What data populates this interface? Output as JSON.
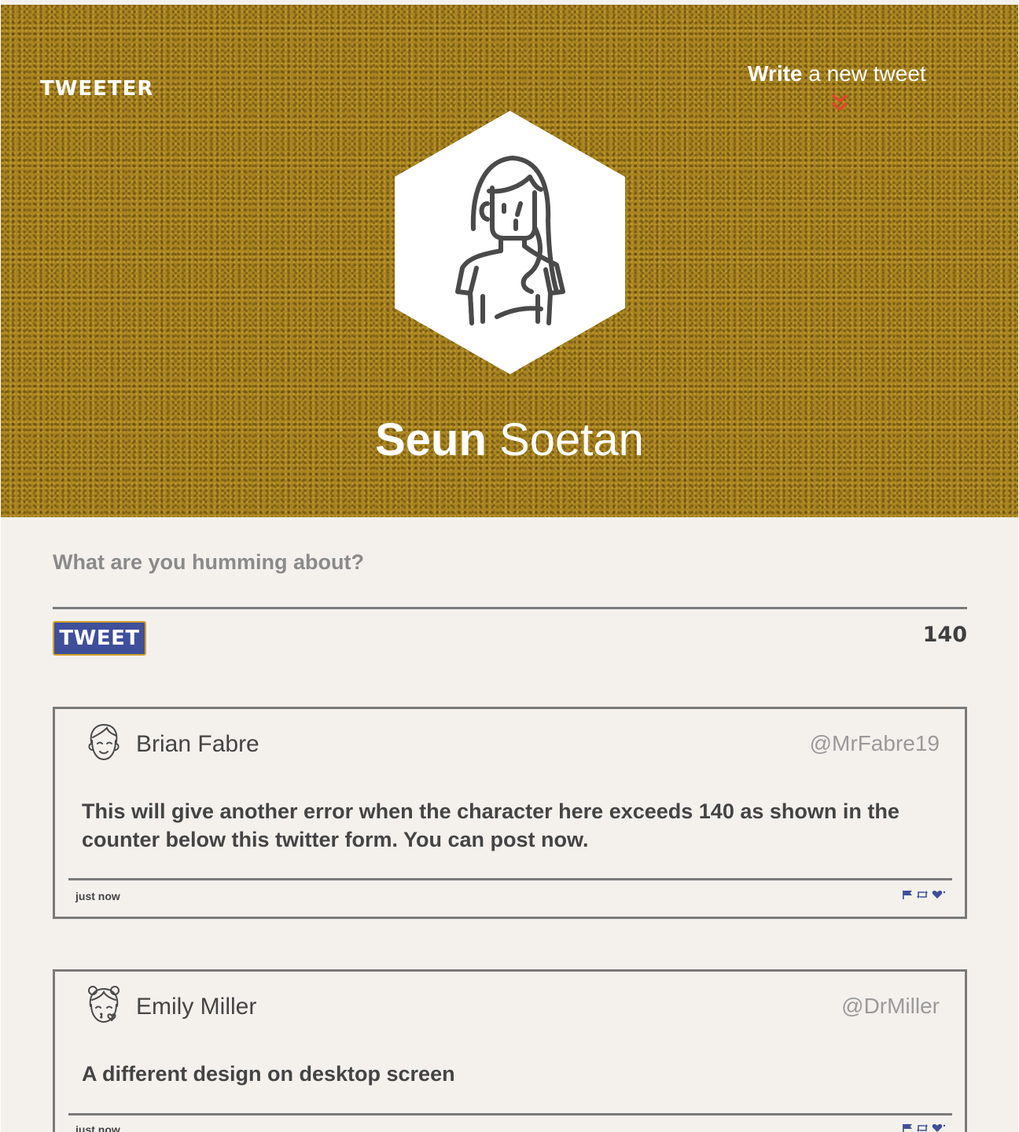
{
  "header": {
    "brand": "TWEETER",
    "write_link_strong": "Write",
    "write_link_rest": " a new tweet",
    "profile_first_name": "Seun",
    "profile_last_name": " Soetan",
    "background_color": "#a8831f"
  },
  "composer": {
    "placeholder": "What are you humming about?",
    "value": "",
    "tweet_button_label": "TWEET",
    "char_counter": "140",
    "button_color": "#3f4f9a"
  },
  "tweets": [
    {
      "name": "Brian Fabre",
      "handle": "@MrFabre19",
      "text": "This will give another error when the character here exceeds 140 as shown in the counter below this twitter form. You can post now.",
      "time": "just now",
      "avatar_icon": "boy-face-icon",
      "actions": [
        "flag-icon",
        "retweet-icon",
        "heart-icon"
      ]
    },
    {
      "name": "Emily Miller",
      "handle": "@DrMiller",
      "text": "A different design on desktop screen",
      "time": "just now",
      "avatar_icon": "girl-kiss-face-icon",
      "actions": [
        "flag-icon",
        "retweet-icon",
        "heart-icon"
      ]
    }
  ],
  "colors": {
    "accent_red": "#e8412c",
    "action_blue": "#3f4f9a",
    "page_background": "#f4f1ed"
  }
}
